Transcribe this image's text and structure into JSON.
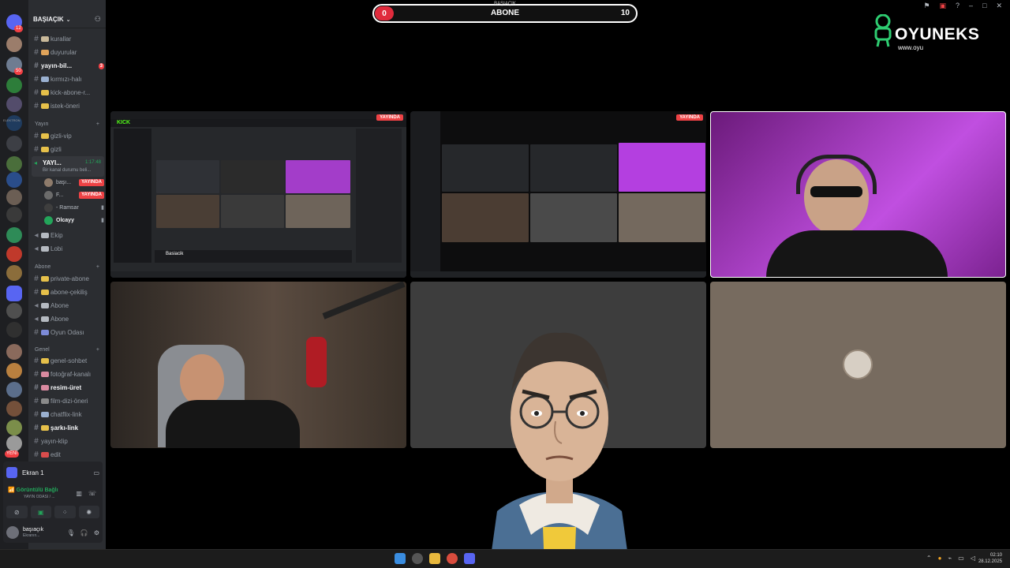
{
  "discord": {
    "server_name": "BAŞIAÇIK",
    "rail_badges": [
      "12",
      "50",
      "1",
      "1",
      "5",
      "1",
      "3",
      "3",
      "1"
    ],
    "rail_labels": {
      "new_tag": "YENİ",
      "server_tag": "ELEKTRON"
    },
    "channels_top": [
      {
        "icon": "📋",
        "name": "kurallar",
        "bold": false
      },
      {
        "icon": "📢",
        "name": "duyurular",
        "bold": false
      },
      {
        "icon": "",
        "name": "yayın-bil...",
        "bold": true,
        "badge": "3"
      },
      {
        "icon": "💬",
        "name": "kırmızı-halı",
        "bold": false
      },
      {
        "icon": "🌟",
        "name": "kick-abone-r...",
        "bold": false
      },
      {
        "icon": "🌟",
        "name": "istek-öneri",
        "bold": false
      }
    ],
    "category_yayin": "Yayın",
    "channels_yayin": [
      {
        "icon": "👑",
        "name": "gizli-vip"
      },
      {
        "icon": "👑",
        "name": "gizli"
      }
    ],
    "voice_channel": {
      "name": "YAYI...",
      "time": "1:17:48",
      "sub": "Bir kanal durumu beli..."
    },
    "voice_users": [
      {
        "name": "başı...",
        "tag": "YAYINDA"
      },
      {
        "name": "F...",
        "tag": "YAYINDA"
      },
      {
        "name": "- Ramsar",
        "tag": ""
      },
      {
        "name": "Olcayy",
        "tag": ""
      }
    ],
    "channels_after": [
      {
        "icon": "🔊",
        "name": "Ekip"
      },
      {
        "icon": "🔒",
        "name": "Lobi"
      }
    ],
    "category_abone": "Abone",
    "channels_abone": [
      {
        "icon": "🌟",
        "name": "private-abone"
      },
      {
        "icon": "🌟",
        "name": "abone-çekiliş"
      },
      {
        "icon": "🔊",
        "name": "Abone"
      },
      {
        "icon": "🔒",
        "name": "Abone"
      },
      {
        "icon": "🎮",
        "name": "Oyun Odası"
      }
    ],
    "category_genel": "Genel",
    "channels_genel": [
      {
        "icon": "🌟",
        "name": "genel-sohbet",
        "bold": false
      },
      {
        "icon": "🎨",
        "name": "fotoğraf-kanalı",
        "bold": false
      },
      {
        "icon": "🎨",
        "name": "resim-üret",
        "bold": true
      },
      {
        "icon": "🎬",
        "name": "film-dizi-öneri",
        "bold": false
      },
      {
        "icon": "💬",
        "name": "chatflix-link",
        "bold": false
      },
      {
        "icon": "🌟",
        "name": "şarkı-link",
        "bold": true
      },
      {
        "icon": "",
        "name": "yayın-klip",
        "bold": false
      },
      {
        "icon": "❌",
        "name": "edit",
        "bold": false
      }
    ],
    "panel": {
      "screen": "Ekran 1",
      "conn": "Görüntülü Bağlı",
      "conn_sub": "YAYIN ODASI / ...",
      "username": "başıaçık",
      "status": "Ekranın..."
    }
  },
  "overlay": {
    "score_left": "0",
    "score_right": "10",
    "score_label": "ABONE",
    "score_small": "BAŞIAÇIK",
    "logo_word": "OYUNEKS",
    "logo_url": "www.oyu"
  },
  "tiles": {
    "live_tag": "YAYINDA",
    "mini_brand": "KICK",
    "mini_streamer": "Basiacik"
  },
  "clock": {
    "time": "02:10",
    "date": "28.12.2025"
  },
  "colors": {
    "live": "#ed4245",
    "accent": "#5865f2",
    "online": "#23a55a",
    "score_red": "#e02b3c"
  }
}
